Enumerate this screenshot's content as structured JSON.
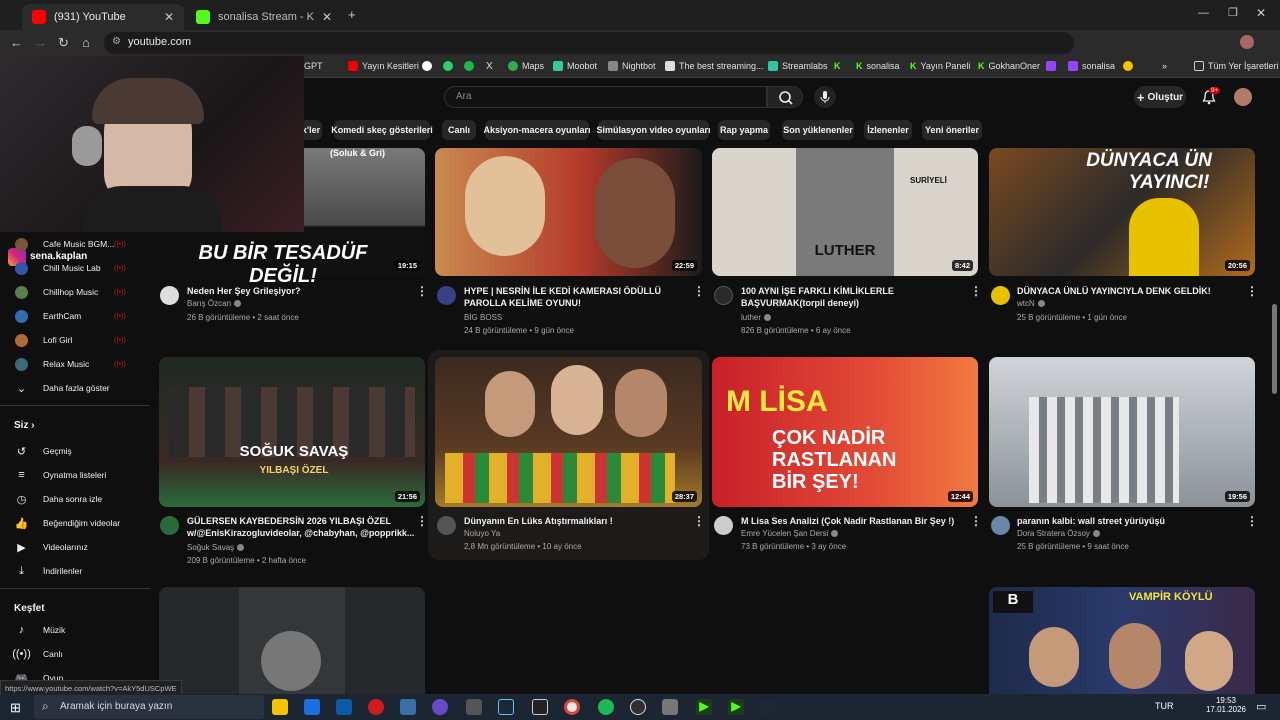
{
  "browser": {
    "tabs": [
      {
        "label": "(931) YouTube"
      },
      {
        "label": "sonalisa Stream - Kick Dashbo"
      }
    ],
    "url": "youtube.com",
    "bookmarks": [
      "GPT",
      "Yayın Kesitleri",
      "Maps",
      "Moobot",
      "Nightbot",
      "The best streaming...",
      "Streamlabs",
      "sonalisa",
      "Yayın Paneli",
      "GokhanOner",
      "sonalisa",
      "Tüm Yer İşaretleri"
    ]
  },
  "youtube": {
    "search_placeholder": "Ara",
    "create_label": "Oluştur",
    "notif_count": "9+",
    "chips": [
      "x'ler",
      "Komedi skeç gösterileri",
      "Canlı",
      "Aksiyon-macera oyunları",
      "Simülasyon video oyunları",
      "Rap yapma",
      "Son yüklenenler",
      "İzlenenler",
      "Yeni öneriler"
    ]
  },
  "overlay": {
    "instagram_handle": "sena.kaplan"
  },
  "sidebar": {
    "subscriptions": [
      {
        "label": "Cafe Music BGM..."
      },
      {
        "label": "Chill Music Lab"
      },
      {
        "label": "Chillhop Music"
      },
      {
        "label": "EarthCam"
      },
      {
        "label": "Lofi Girl"
      },
      {
        "label": "Relax Music"
      }
    ],
    "show_more": "Daha fazla göster",
    "you_title": "Siz",
    "you_items": [
      {
        "label": "Geçmiş"
      },
      {
        "label": "Oynatma listeleri"
      },
      {
        "label": "Daha sonra izle"
      },
      {
        "label": "Beğendiğim videolar"
      },
      {
        "label": "Videolarınız"
      },
      {
        "label": "İndirilenler"
      }
    ],
    "explore_title": "Keşfet",
    "explore_items": [
      {
        "label": "Müzik"
      },
      {
        "label": "Canlı"
      },
      {
        "label": "Oyun"
      }
    ]
  },
  "videos": [
    {
      "title1": "Neden Her Şey Grileşiyor?",
      "title2": "",
      "channel": "Barış Özcan",
      "views": "26 B görüntüleme",
      "age": "2 saat önce",
      "duration": "19:15",
      "thumb_text": "BU BİR TESADÜF DEĞİL!",
      "thumb_sub": "(Soluk & Gri)"
    },
    {
      "title1": "HYPE | NESRİN İLE KEDİ KAMERASI ÖDÜLLÜ",
      "title2": "PAROLLA KELİME OYUNU!",
      "channel": "BİG BOSS",
      "views": "24 B görüntüleme",
      "age": "9 gün önce",
      "duration": "22:59",
      "thumb_text": "",
      "thumb_sub": ""
    },
    {
      "title1": "100 AYNI İŞE FARKLI KİMLİKLERLE",
      "title2": "BAŞVURMAK(torpil deneyi)",
      "channel": "luther",
      "views": "826 B görüntüleme",
      "age": "6 ay önce",
      "duration": "8:42",
      "thumb_text": "LUTHER",
      "thumb_sub": "SURİYELİ"
    },
    {
      "title1": "DÜNYACA ÜNLÜ YAYINCIYLA DENK GELDİK!",
      "title2": "",
      "channel": "wtcN",
      "views": "25 B görüntüleme",
      "age": "1 gün önce",
      "duration": "20:56",
      "thumb_text": "DÜNYACA ÜN",
      "thumb_sub": "YAYINCI!"
    },
    {
      "title1": "GÜLERSEN KAYBEDERSİN 2026 YILBAŞI ÖZEL",
      "title2": "w/@EnisKirazogluvideolar, @chabyhan, @popprikk...",
      "channel": "Soğuk Savaş",
      "views": "209 B görüntüleme",
      "age": "2 hafta önce",
      "duration": "21:56",
      "thumb_text": "SOĞUK SAVAŞ",
      "thumb_sub": "YILBAŞI ÖZEL"
    },
    {
      "title1": "Dünyanın En Lüks Atıştırmalıkları !",
      "title2": "",
      "channel": "Noluyo Ya",
      "views": "2,8 Mn görüntüleme",
      "age": "10 ay önce",
      "duration": "28:37",
      "thumb_text": "",
      "thumb_sub": ""
    },
    {
      "title1": "M Lisa Ses Analizi (Çok Nadir Rastlanan Bir Şey !)",
      "title2": "",
      "channel": "Emre Yücelen Şan Dersi",
      "views": "73 B görüntüleme",
      "age": "3 ay önce",
      "duration": "12:44",
      "thumb_text": "M LİSA",
      "thumb_sub": "ÇOK NADİR RASTLANAN BİR ŞEY!"
    },
    {
      "title1": "paranın kalbi: wall street yürüyüşü",
      "title2": "",
      "channel": "Dora Stratera Özsoy",
      "views": "25 B görüntüleme",
      "age": "9 saat önce",
      "duration": "19:56",
      "thumb_text": "",
      "thumb_sub": ""
    },
    {
      "title1": "",
      "title2": "",
      "channel": "",
      "views": "",
      "age": "",
      "duration": "",
      "thumb_text": "VAMPİR KÖYLÜ",
      "thumb_sub": ""
    }
  ],
  "status_url": "https://www.youtube.com/watch?v=AkY5dUSCpWE",
  "taskbar": {
    "search": "Aramak için buraya yazın",
    "lang": "TUR",
    "time": "19:53",
    "date": "17.01.2026"
  }
}
